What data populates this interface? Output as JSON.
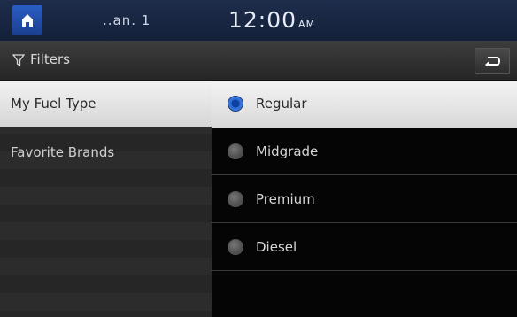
{
  "status_bar": {
    "signal_text": "..an.  1",
    "time": "12:00",
    "ampm": "AM"
  },
  "title_bar": {
    "title": "Filters"
  },
  "sidebar": {
    "items": [
      {
        "label": "My Fuel Type",
        "active": true
      },
      {
        "label": "Favorite Brands",
        "active": false
      }
    ]
  },
  "options": {
    "items": [
      {
        "label": "Regular",
        "selected": true
      },
      {
        "label": "Midgrade",
        "selected": false
      },
      {
        "label": "Premium",
        "selected": false
      },
      {
        "label": "Diesel",
        "selected": false
      }
    ]
  },
  "icons": [
    "home-icon",
    "filter-icon",
    "back-icon"
  ],
  "colors": {
    "accent": "#2a5dc2",
    "status_bar": "#1a2944",
    "selected_bg": "#e6e6e6"
  }
}
